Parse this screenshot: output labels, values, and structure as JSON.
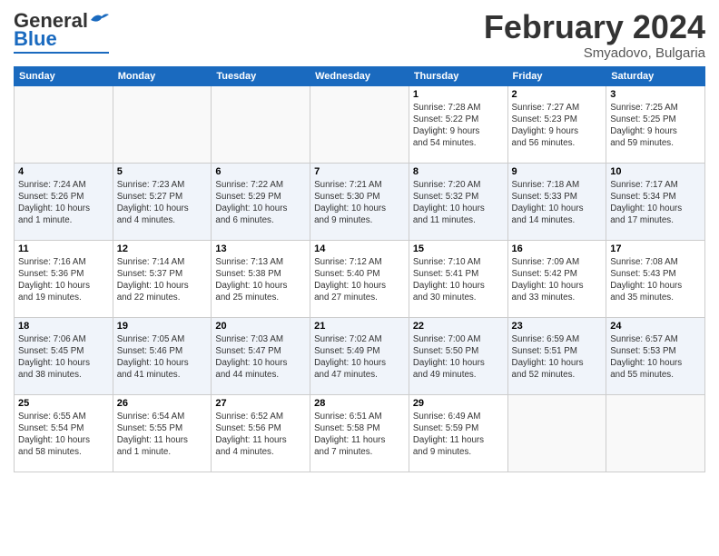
{
  "header": {
    "logo_general": "General",
    "logo_blue": "Blue",
    "month_title": "February 2024",
    "location": "Smyadovo, Bulgaria"
  },
  "days_of_week": [
    "Sunday",
    "Monday",
    "Tuesday",
    "Wednesday",
    "Thursday",
    "Friday",
    "Saturday"
  ],
  "weeks": [
    [
      {
        "day": "",
        "info": ""
      },
      {
        "day": "",
        "info": ""
      },
      {
        "day": "",
        "info": ""
      },
      {
        "day": "",
        "info": ""
      },
      {
        "day": "1",
        "info": "Sunrise: 7:28 AM\nSunset: 5:22 PM\nDaylight: 9 hours\nand 54 minutes."
      },
      {
        "day": "2",
        "info": "Sunrise: 7:27 AM\nSunset: 5:23 PM\nDaylight: 9 hours\nand 56 minutes."
      },
      {
        "day": "3",
        "info": "Sunrise: 7:25 AM\nSunset: 5:25 PM\nDaylight: 9 hours\nand 59 minutes."
      }
    ],
    [
      {
        "day": "4",
        "info": "Sunrise: 7:24 AM\nSunset: 5:26 PM\nDaylight: 10 hours\nand 1 minute."
      },
      {
        "day": "5",
        "info": "Sunrise: 7:23 AM\nSunset: 5:27 PM\nDaylight: 10 hours\nand 4 minutes."
      },
      {
        "day": "6",
        "info": "Sunrise: 7:22 AM\nSunset: 5:29 PM\nDaylight: 10 hours\nand 6 minutes."
      },
      {
        "day": "7",
        "info": "Sunrise: 7:21 AM\nSunset: 5:30 PM\nDaylight: 10 hours\nand 9 minutes."
      },
      {
        "day": "8",
        "info": "Sunrise: 7:20 AM\nSunset: 5:32 PM\nDaylight: 10 hours\nand 11 minutes."
      },
      {
        "day": "9",
        "info": "Sunrise: 7:18 AM\nSunset: 5:33 PM\nDaylight: 10 hours\nand 14 minutes."
      },
      {
        "day": "10",
        "info": "Sunrise: 7:17 AM\nSunset: 5:34 PM\nDaylight: 10 hours\nand 17 minutes."
      }
    ],
    [
      {
        "day": "11",
        "info": "Sunrise: 7:16 AM\nSunset: 5:36 PM\nDaylight: 10 hours\nand 19 minutes."
      },
      {
        "day": "12",
        "info": "Sunrise: 7:14 AM\nSunset: 5:37 PM\nDaylight: 10 hours\nand 22 minutes."
      },
      {
        "day": "13",
        "info": "Sunrise: 7:13 AM\nSunset: 5:38 PM\nDaylight: 10 hours\nand 25 minutes."
      },
      {
        "day": "14",
        "info": "Sunrise: 7:12 AM\nSunset: 5:40 PM\nDaylight: 10 hours\nand 27 minutes."
      },
      {
        "day": "15",
        "info": "Sunrise: 7:10 AM\nSunset: 5:41 PM\nDaylight: 10 hours\nand 30 minutes."
      },
      {
        "day": "16",
        "info": "Sunrise: 7:09 AM\nSunset: 5:42 PM\nDaylight: 10 hours\nand 33 minutes."
      },
      {
        "day": "17",
        "info": "Sunrise: 7:08 AM\nSunset: 5:43 PM\nDaylight: 10 hours\nand 35 minutes."
      }
    ],
    [
      {
        "day": "18",
        "info": "Sunrise: 7:06 AM\nSunset: 5:45 PM\nDaylight: 10 hours\nand 38 minutes."
      },
      {
        "day": "19",
        "info": "Sunrise: 7:05 AM\nSunset: 5:46 PM\nDaylight: 10 hours\nand 41 minutes."
      },
      {
        "day": "20",
        "info": "Sunrise: 7:03 AM\nSunset: 5:47 PM\nDaylight: 10 hours\nand 44 minutes."
      },
      {
        "day": "21",
        "info": "Sunrise: 7:02 AM\nSunset: 5:49 PM\nDaylight: 10 hours\nand 47 minutes."
      },
      {
        "day": "22",
        "info": "Sunrise: 7:00 AM\nSunset: 5:50 PM\nDaylight: 10 hours\nand 49 minutes."
      },
      {
        "day": "23",
        "info": "Sunrise: 6:59 AM\nSunset: 5:51 PM\nDaylight: 10 hours\nand 52 minutes."
      },
      {
        "day": "24",
        "info": "Sunrise: 6:57 AM\nSunset: 5:53 PM\nDaylight: 10 hours\nand 55 minutes."
      }
    ],
    [
      {
        "day": "25",
        "info": "Sunrise: 6:55 AM\nSunset: 5:54 PM\nDaylight: 10 hours\nand 58 minutes."
      },
      {
        "day": "26",
        "info": "Sunrise: 6:54 AM\nSunset: 5:55 PM\nDaylight: 11 hours\nand 1 minute."
      },
      {
        "day": "27",
        "info": "Sunrise: 6:52 AM\nSunset: 5:56 PM\nDaylight: 11 hours\nand 4 minutes."
      },
      {
        "day": "28",
        "info": "Sunrise: 6:51 AM\nSunset: 5:58 PM\nDaylight: 11 hours\nand 7 minutes."
      },
      {
        "day": "29",
        "info": "Sunrise: 6:49 AM\nSunset: 5:59 PM\nDaylight: 11 hours\nand 9 minutes."
      },
      {
        "day": "",
        "info": ""
      },
      {
        "day": "",
        "info": ""
      }
    ]
  ]
}
